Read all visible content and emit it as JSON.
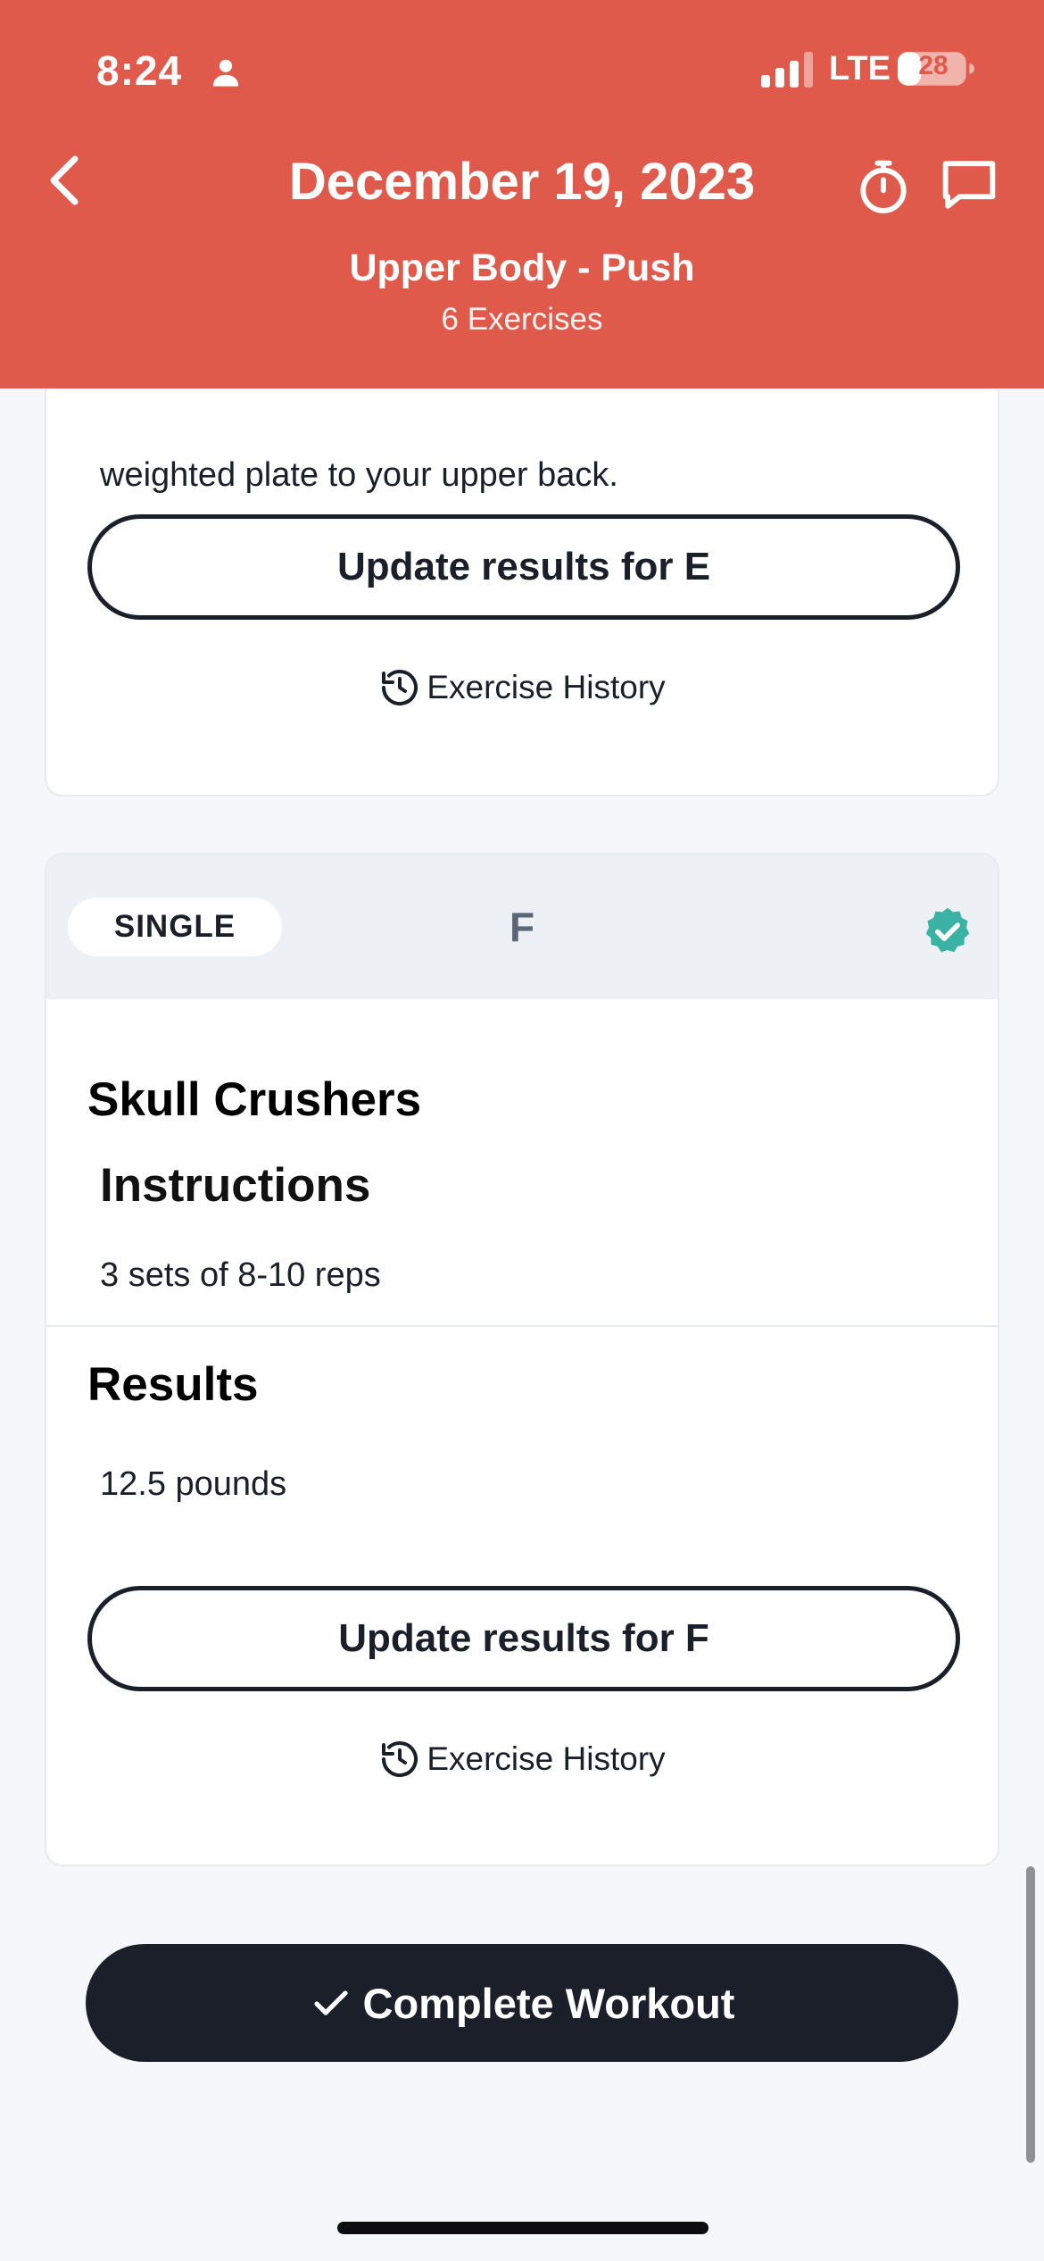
{
  "status_bar": {
    "time": "8:24",
    "network": "LTE",
    "battery": "28"
  },
  "header": {
    "title": "December 19, 2023",
    "workout_name": "Upper Body - Push",
    "exercise_count": "6 Exercises"
  },
  "card_e": {
    "description": "weighted plate to your upper back.",
    "update_button": "Update results for E",
    "history_link": "Exercise History"
  },
  "card_f": {
    "type_badge": "SINGLE",
    "letter": "F",
    "exercise_name": "Skull Crushers",
    "instructions_heading": "Instructions",
    "instructions": "3 sets of 8-10 reps",
    "results_heading": "Results",
    "results": "12.5 pounds",
    "update_button": "Update results for F",
    "history_link": "Exercise History"
  },
  "complete_button": "Complete Workout",
  "colors": {
    "header": "#e05a4b",
    "primary_dark": "#1b1f2a",
    "check_teal": "#3bb3a4"
  },
  "icons": [
    "person-icon",
    "signal-icon",
    "battery-icon",
    "back-chevron-icon",
    "timer-icon",
    "chat-icon",
    "history-icon",
    "check-badge-icon",
    "checkmark-icon"
  ]
}
